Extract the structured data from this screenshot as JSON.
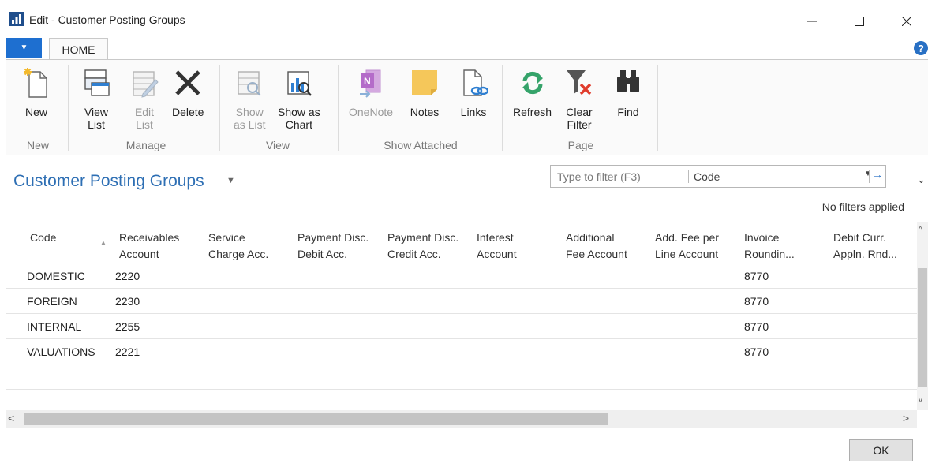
{
  "window": {
    "title": "Edit - Customer Posting Groups"
  },
  "ribbon": {
    "tab": "HOME",
    "groups": [
      {
        "label": "New",
        "buttons": [
          {
            "label": "New",
            "enabled": true
          }
        ]
      },
      {
        "label": "Manage",
        "buttons": [
          {
            "label": "View\nList",
            "enabled": true
          },
          {
            "label": "Edit\nList",
            "enabled": false
          },
          {
            "label": "Delete",
            "enabled": true
          }
        ]
      },
      {
        "label": "View",
        "buttons": [
          {
            "label": "Show\nas List",
            "enabled": false
          },
          {
            "label": "Show as\nChart",
            "enabled": true
          }
        ]
      },
      {
        "label": "Show Attached",
        "buttons": [
          {
            "label": "OneNote",
            "enabled": false
          },
          {
            "label": "Notes",
            "enabled": true
          },
          {
            "label": "Links",
            "enabled": true
          }
        ]
      },
      {
        "label": "Page",
        "buttons": [
          {
            "label": "Refresh",
            "enabled": true
          },
          {
            "label": "Clear\nFilter",
            "enabled": true
          },
          {
            "label": "Find",
            "enabled": true
          }
        ]
      }
    ]
  },
  "page": {
    "title": "Customer Posting Groups",
    "filter": {
      "placeholder": "Type to filter (F3)",
      "field": "Code"
    },
    "filter_status": "No filters applied"
  },
  "table": {
    "columns": [
      "Code",
      "Receivables\nAccount",
      "Service\nCharge Acc.",
      "Payment Disc.\nDebit Acc.",
      "Payment Disc.\nCredit Acc.",
      "Interest\nAccount",
      "Additional\nFee Account",
      "Add. Fee per\nLine Account",
      "Invoice\nRoundin...",
      "Debit Curr.\nAppln. Rnd..."
    ],
    "rows": [
      {
        "code": "DOMESTIC",
        "receivables": "2220",
        "invoice_rounding": "8770"
      },
      {
        "code": "FOREIGN",
        "receivables": "2230",
        "invoice_rounding": "8770"
      },
      {
        "code": "INTERNAL",
        "receivables": "2255",
        "invoice_rounding": "8770"
      },
      {
        "code": "VALUATIONS",
        "receivables": "2221",
        "invoice_rounding": "8770"
      }
    ]
  },
  "footer": {
    "ok_label": "OK"
  }
}
